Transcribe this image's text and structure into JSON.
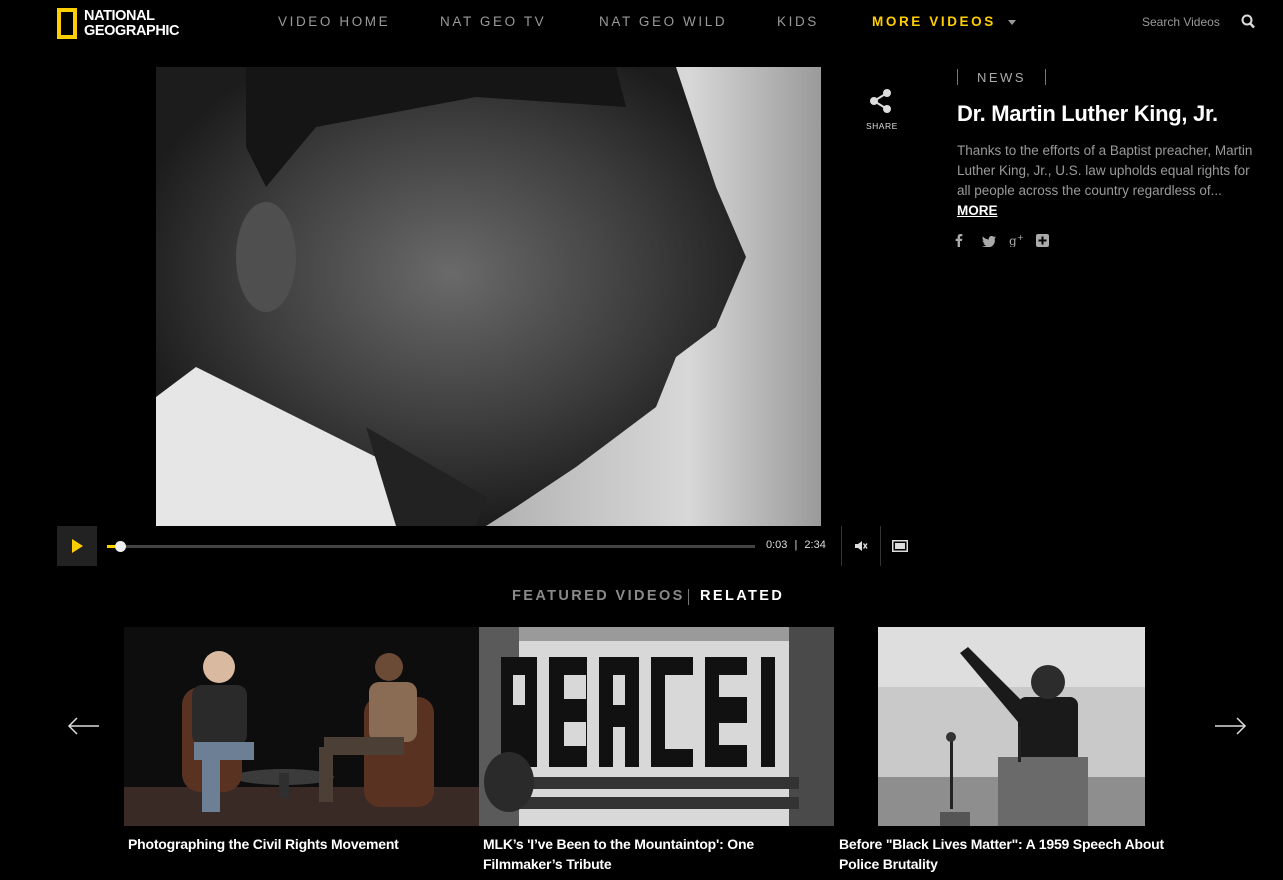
{
  "header": {
    "logo_text_line1": "NATIONAL",
    "logo_text_line2": "GEOGRAPHIC",
    "nav": [
      {
        "label": "VIDEO HOME"
      },
      {
        "label": "NAT GEO TV"
      },
      {
        "label": "NAT GEO WILD"
      },
      {
        "label": "KIDS"
      },
      {
        "label": "MORE VIDEOS"
      }
    ],
    "search_placeholder": "Search Videos"
  },
  "player": {
    "current_time": "0:03",
    "duration": "2:34",
    "progress_fraction": 0.02
  },
  "share": {
    "label": "SHARE"
  },
  "video_info": {
    "category": "NEWS",
    "title": "Dr. Martin Luther King, Jr.",
    "description": "Thanks to the efforts of a Baptist preacher, Martin Luther King, Jr., U.S. law upholds equal rights for all people across the country regardless of...",
    "more_label": "MORE",
    "social_icons": [
      "facebook-icon",
      "twitter-icon",
      "google-plus-icon",
      "add-icon"
    ]
  },
  "related": {
    "tabs": [
      "FEATURED VIDEOS",
      "RELATED"
    ],
    "active_tab": "RELATED",
    "items": [
      {
        "title": "Photographing the Civil Rights Movement"
      },
      {
        "title": "MLK’s 'I’ve Been to the Mountaintop': One Filmmaker’s Tribute"
      },
      {
        "title": "Before \"Black Lives Matter\": A 1959 Speech About Police Brutality"
      }
    ]
  },
  "colors": {
    "accent": "#FFCE00",
    "background": "#000000",
    "muted_text": "#9A9A9A"
  }
}
